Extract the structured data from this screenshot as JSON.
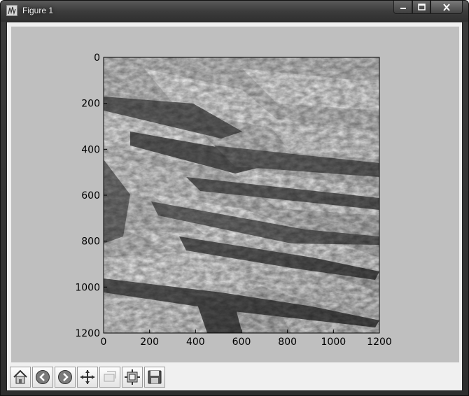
{
  "window": {
    "title": "Figure 1",
    "buttons": [
      "minimize-icon",
      "maximize-icon",
      "close-icon"
    ]
  },
  "figure": {
    "background": "#bfbfbf",
    "image_description_icon": "hillshade-raster",
    "xaxis": {
      "ticks": [
        "0",
        "200",
        "400",
        "600",
        "800",
        "1000",
        "1200"
      ],
      "range": [
        0,
        1200
      ]
    },
    "yaxis": {
      "ticks": [
        "0",
        "200",
        "400",
        "600",
        "800",
        "1000",
        "1200"
      ],
      "range": [
        0,
        1200
      ],
      "inverted": true
    }
  },
  "toolbar": {
    "items": [
      {
        "name": "home",
        "icon": "home-icon"
      },
      {
        "name": "back",
        "icon": "back-arrow-icon"
      },
      {
        "name": "forward",
        "icon": "forward-arrow-icon"
      },
      {
        "name": "pan",
        "icon": "pan-arrows-icon"
      },
      {
        "name": "zoom",
        "icon": "zoom-rect-icon"
      },
      {
        "name": "subplots",
        "icon": "subplots-config-icon"
      },
      {
        "name": "save",
        "icon": "save-disk-icon"
      }
    ]
  }
}
